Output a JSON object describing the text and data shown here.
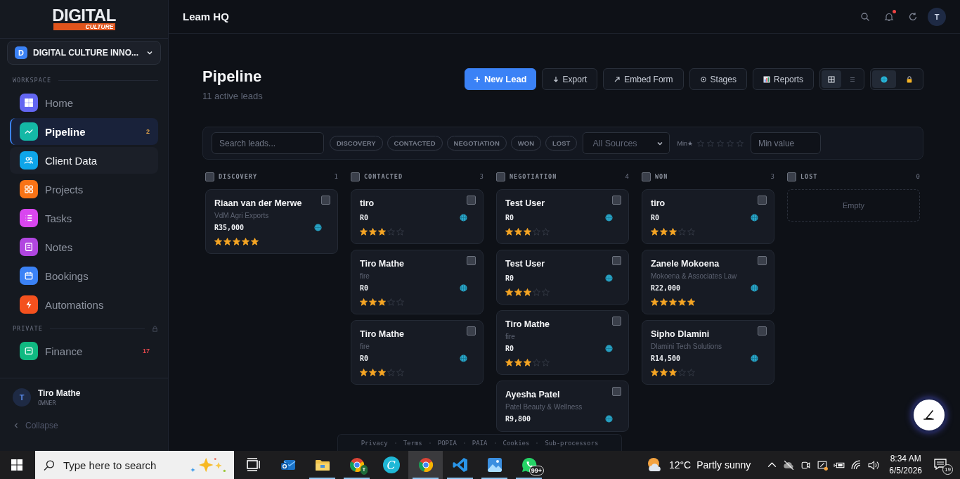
{
  "sidebar": {
    "logo": {
      "title": "DIGITAL",
      "subtitle": "CULTURE"
    },
    "org": {
      "initial": "D",
      "name": "DIGITAL CULTURE INNO..."
    },
    "sections": [
      {
        "label": "WORKSPACE",
        "locked": false,
        "items": [
          {
            "label": "Home",
            "kind": "grid",
            "color": "#6366f1",
            "selected": false,
            "hovered": false
          },
          {
            "label": "Pipeline",
            "kind": "trend",
            "color": "#14b8a6",
            "selected": true,
            "hovered": false,
            "badge": "2"
          },
          {
            "label": "Client Data",
            "kind": "users",
            "color": "#0ea5e9",
            "selected": false,
            "hovered": true
          },
          {
            "label": "Projects",
            "kind": "apps",
            "color": "#f97316",
            "selected": false,
            "hovered": false
          },
          {
            "label": "Tasks",
            "kind": "list",
            "color": "#d946ef",
            "selected": false,
            "hovered": false
          },
          {
            "label": "Notes",
            "kind": "note",
            "color": "#b146e0",
            "selected": false,
            "hovered": false
          },
          {
            "label": "Bookings",
            "kind": "calendar",
            "color": "#3b82f6",
            "selected": false,
            "hovered": false
          },
          {
            "label": "Automations",
            "kind": "bolt",
            "color": "#f4511e",
            "selected": false,
            "hovered": false
          }
        ]
      },
      {
        "label": "PRIVATE",
        "locked": true,
        "items": [
          {
            "label": "Finance",
            "kind": "finance",
            "color": "#10b981",
            "selected": false,
            "hovered": false,
            "badge": "17"
          }
        ]
      }
    ],
    "user": {
      "initial": "T",
      "name": "Tiro Mathe",
      "role": "OWNER"
    },
    "collapse": "Collapse"
  },
  "topbar": {
    "title": "Leam HQ",
    "unread": true,
    "avatar": "T"
  },
  "header": {
    "title": "Pipeline",
    "subtitle": "11 active leads",
    "actions": [
      {
        "label": "New Lead",
        "kind": "plus",
        "primary": true
      },
      {
        "label": "Export",
        "kind": "download",
        "primary": false
      },
      {
        "label": "Embed Form",
        "kind": "arrow",
        "primary": false
      },
      {
        "label": "Stages",
        "kind": "gear",
        "primary": false
      },
      {
        "label": "Reports",
        "kind": "chart",
        "primary": false
      }
    ],
    "view_modes": [
      {
        "kind": "grid",
        "selected": true
      },
      {
        "kind": "list",
        "selected": false
      }
    ],
    "toggles": [
      {
        "kind": "globe",
        "selected": true
      },
      {
        "kind": "lock",
        "selected": false
      }
    ]
  },
  "filters": {
    "search": {
      "placeholder": "Search leads..."
    },
    "stages": [
      {
        "label": "DISCOVERY",
        "selected": false
      },
      {
        "label": "CONTACTED",
        "selected": false
      },
      {
        "label": "NEGOTIATION",
        "selected": false
      },
      {
        "label": "WON",
        "selected": false
      },
      {
        "label": "LOST",
        "selected": false
      }
    ],
    "source": {
      "value": "All Sources"
    },
    "min_stars": {
      "label": "Min★",
      "stars": 0
    },
    "min_value": {
      "placeholder": "Min value"
    }
  },
  "board": {
    "columns": [
      {
        "title": "DISCOVERY",
        "count": "1",
        "checked": false,
        "cards": [
          {
            "name": "Riaan van der Merwe",
            "company": "VdM Agri Exports",
            "value": "R35,000",
            "stars": 5,
            "checked": false
          }
        ]
      },
      {
        "title": "CONTACTED",
        "count": "3",
        "checked": false,
        "cards": [
          {
            "name": "tiro",
            "value": "R0",
            "stars": 3,
            "checked": false
          },
          {
            "name": "Tiro Mathe",
            "company": "fire",
            "value": "R0",
            "stars": 3,
            "checked": false
          },
          {
            "name": "Tiro Mathe",
            "company": "fire",
            "value": "R0",
            "stars": 3,
            "checked": false
          }
        ]
      },
      {
        "title": "NEGOTIATION",
        "count": "4",
        "checked": false,
        "cards": [
          {
            "name": "Test User",
            "value": "R0",
            "stars": 3,
            "checked": false
          },
          {
            "name": "Test User",
            "value": "R0",
            "stars": 3,
            "checked": false
          },
          {
            "name": "Tiro Mathe",
            "company": "fire",
            "value": "R0",
            "stars": 3,
            "checked": false
          },
          {
            "name": "Ayesha Patel",
            "company": "Patel Beauty & Wellness",
            "value": "R9,800",
            "checked": false
          }
        ]
      },
      {
        "title": "WON",
        "count": "3",
        "checked": false,
        "cards": [
          {
            "name": "tiro",
            "value": "R0",
            "stars": 3,
            "checked": false
          },
          {
            "name": "Zanele Mokoena",
            "company": "Mokoena & Associates Law",
            "value": "R22,000",
            "stars": 5,
            "checked": false
          },
          {
            "name": "Sipho Dlamini",
            "company": "Dlamini Tech Solutions",
            "value": "R14,500",
            "stars": 3,
            "checked": false
          }
        ]
      },
      {
        "title": "LOST",
        "count": "0",
        "checked": false,
        "empty": "Empty"
      }
    ]
  },
  "footer_links": [
    "Privacy",
    "Terms",
    "POPIA",
    "PAIA",
    "Cookies",
    "Sub-processors"
  ],
  "taskbar": {
    "search": {
      "placeholder": "Type here to search"
    },
    "apps": [
      {
        "kind": "task-view",
        "running": false,
        "selected": false
      },
      {
        "kind": "outlook",
        "running": false,
        "selected": false
      },
      {
        "kind": "explorer",
        "running": true,
        "selected": false
      },
      {
        "kind": "chrome",
        "running": true,
        "selected": false,
        "badge": "T"
      },
      {
        "kind": "canva",
        "running": false,
        "selected": false,
        "glyph": "C"
      },
      {
        "kind": "chrome",
        "running": true,
        "selected": true
      },
      {
        "kind": "vscode",
        "running": true,
        "selected": false
      },
      {
        "kind": "photos",
        "running": true,
        "selected": false
      },
      {
        "kind": "whatsapp",
        "running": true,
        "selected": false,
        "badge": "99+"
      }
    ],
    "weather": {
      "temp": "12°C",
      "text": "Partly sunny"
    },
    "time": "8:34 AM",
    "date": "6/5/2026",
    "notifications": "19"
  }
}
